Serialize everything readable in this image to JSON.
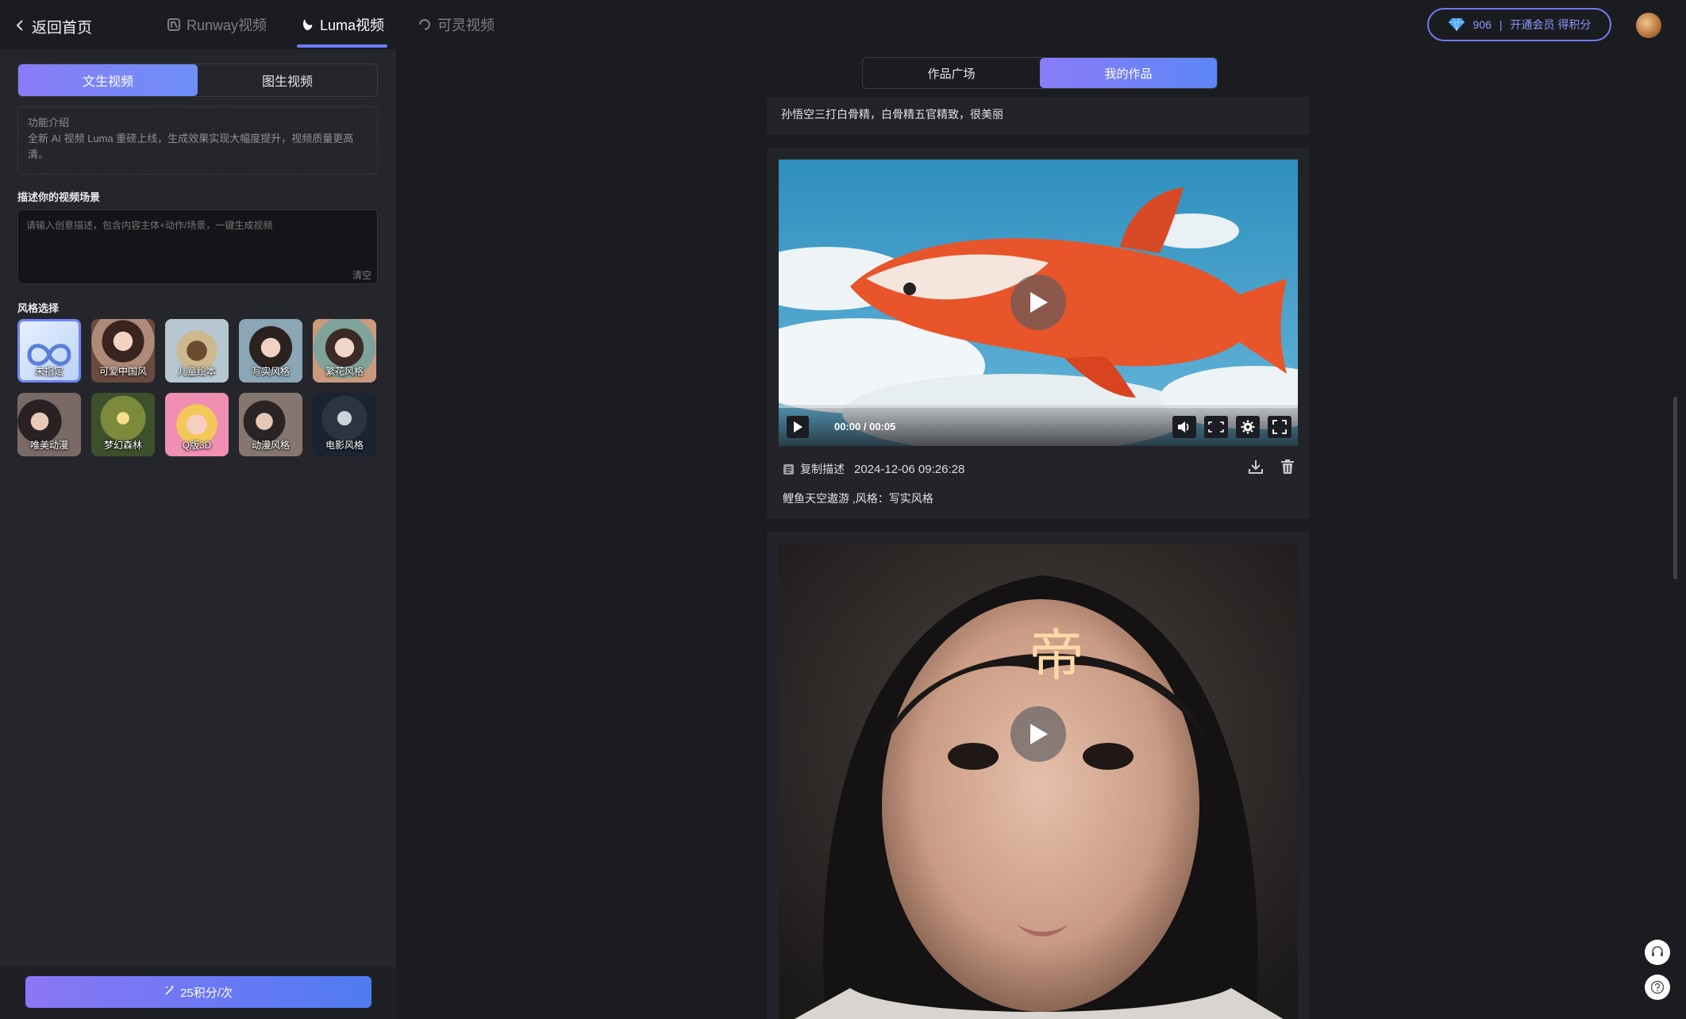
{
  "header": {
    "back_label": "返回首页",
    "tabs": [
      {
        "label": "Runway视频",
        "icon": "runway-icon",
        "active": false
      },
      {
        "label": "Luma视频",
        "icon": "luma-icon",
        "active": true
      },
      {
        "label": "可灵视频",
        "icon": "kling-icon",
        "active": false
      }
    ],
    "points": "906",
    "vip_text": "开通会员 得积分",
    "accent_color": "#6a7cff"
  },
  "sidebar": {
    "mode_tabs": [
      "文生视频",
      "图生视频"
    ],
    "active_mode": "文生视频",
    "intro_title": "功能介绍",
    "intro_text": "全新 AI 视频 Luma 重磅上线，生成效果实现大幅度提升，视频质量更高清。",
    "prompt_label": "描述你的视频场景",
    "prompt_placeholder": "请输入创意描述，包含内容主体+动作/场景，一键生成视频",
    "clear_label": "清空",
    "style_label": "风格选择",
    "styles": [
      "未指定",
      "可爱中国风",
      "儿童绘本",
      "写实风格",
      "繁花风格",
      "唯美动漫",
      "梦幻森林",
      "Q版3D",
      "动漫风格",
      "电影风格"
    ],
    "selected_style": "未指定",
    "generate_label": "25积分/次"
  },
  "main": {
    "view_tabs": [
      "作品广场",
      "我的作品"
    ],
    "active_view": "我的作品",
    "prev_description": "孙悟空三打白骨精，白骨精五官精致，很美丽",
    "works": [
      {
        "time_display": "00:00 / 00:05",
        "copy_label": "复制描述",
        "date": "2024-12-06 09:26:28",
        "description": "鲤鱼天空遨游 ,风格：写实风格",
        "progress": 0
      },
      {
        "overlay_char": "帝"
      }
    ]
  }
}
